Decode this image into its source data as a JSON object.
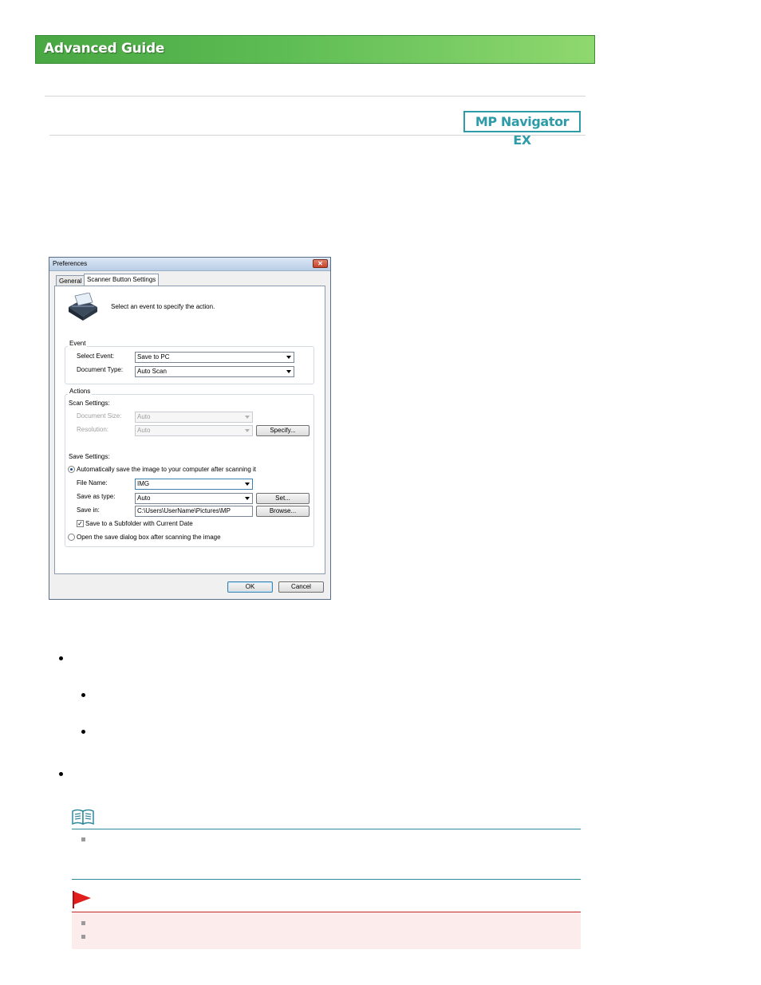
{
  "header": {
    "title": "Advanced Guide",
    "product_badge": "MP Navigator EX"
  },
  "dialog": {
    "title": "Preferences",
    "close_glyph": "✕",
    "tabs": [
      {
        "label": "General"
      },
      {
        "label": "Scanner Button Settings"
      }
    ],
    "instruction": "Select an event to specify the action.",
    "event_group": {
      "label": "Event",
      "select_event_label": "Select Event:",
      "select_event_value": "Save to PC",
      "document_type_label": "Document Type:",
      "document_type_value": "Auto Scan"
    },
    "actions_group": {
      "label": "Actions",
      "scan_settings_label": "Scan Settings:",
      "document_size_label": "Document Size:",
      "document_size_value": "Auto",
      "resolution_label": "Resolution:",
      "resolution_value": "Auto",
      "specify_button": "Specify...",
      "save_settings_label": "Save Settings:",
      "auto_save_option": "Automatically save the image to your computer after scanning it",
      "file_name_label": "File Name:",
      "file_name_value": "IMG",
      "save_as_type_label": "Save as type:",
      "save_as_type_value": "Auto",
      "set_button": "Set...",
      "save_in_label": "Save in:",
      "save_in_value": "C:\\Users\\UserName\\Pictures\\MP Navigator",
      "browse_button": "Browse...",
      "subfolder_checkbox": "Save to a Subfolder with Current Date",
      "open_dialog_option": "Open the save dialog box after scanning the image"
    },
    "ok_button": "OK",
    "cancel_button": "Cancel"
  },
  "icons": {
    "note": "note-book-icon",
    "important": "red-flag-icon",
    "scanner": "scanner-icon"
  },
  "colors": {
    "banner_green": "#5fbd55",
    "badge_teal": "#2e9ca8",
    "important_red": "#e01e1e",
    "important_bg": "#fdecec"
  }
}
